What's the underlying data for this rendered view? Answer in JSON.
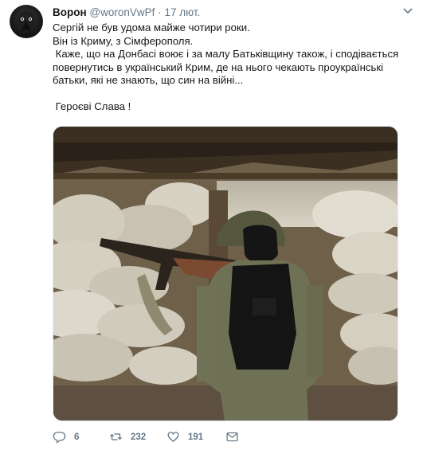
{
  "tweet": {
    "author_name": "Ворон",
    "author_handle": "@woronVwPf",
    "separator": "·",
    "date": "17 лют.",
    "lines": [
      "Сергій не був удома майже чотири роки.",
      "Він із Криму, з Сімферополя.",
      " Каже, що на Донбасі воює і за малу Батьківщину також, і сподівається повернутись в український Крим, де на нього чекають проукраїнські батьки, які не знають, що син на війні...",
      "",
      " Героєві Слава !"
    ]
  },
  "actions": {
    "replies": "6",
    "retweets": "232",
    "likes": "191"
  },
  "icons": {
    "menu": "chevron-down-icon",
    "reply": "reply-icon",
    "retweet": "retweet-icon",
    "like": "heart-icon",
    "dm": "envelope-icon"
  },
  "colors": {
    "text": "#14171a",
    "muted": "#657786"
  }
}
